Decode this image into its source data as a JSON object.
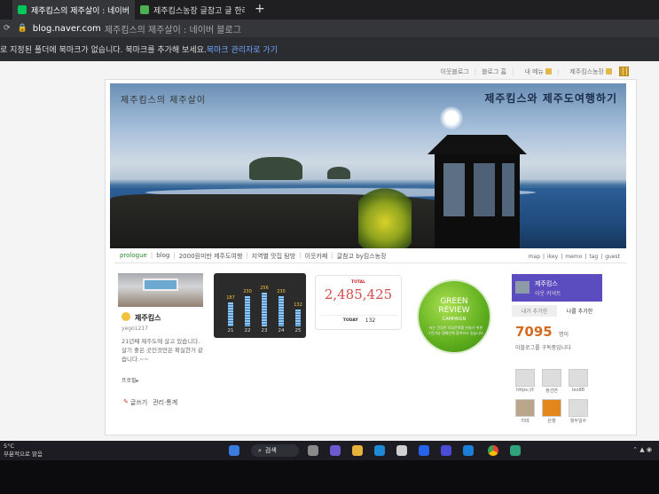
{
  "browser": {
    "tabs": [
      {
        "title": "제주킴스의 제주살이 : 네이버 블"
      },
      {
        "title": "제주킴스농장 글참고 글 한라봉"
      }
    ],
    "newtab": "+",
    "nav_label": "☰",
    "address_host": "blog.naver.com",
    "address_title": "제주킴스의 제주살이 : 네이버 블로그",
    "bookmark_msg": "로 지정된 폴더에 북마크가 없습니다. 북마크를 추가해 보세요.",
    "bookmark_link": "북마크 관리자로 가기"
  },
  "topnav": [
    "이웃블로그",
    "블로그 홈",
    "내 메뉴",
    "제주킴스농장"
  ],
  "banner": {
    "left_title": "제주킴스의 제주살이",
    "right_title": "제주킴스와 제주도여행하기"
  },
  "menu": {
    "items": [
      "prologue",
      "blog",
      "2000원미만 제주도여행",
      "지역별 맛집 탐방",
      "이웃카페",
      "글참고 by킴스농장"
    ],
    "right": [
      "map",
      "ikey",
      "memo",
      "tag",
      "guest"
    ]
  },
  "profile": {
    "name": "제주킴스",
    "id": "yego1217",
    "desc": "21년째 제주도에 살고 있습니다. 살기 좋은 곳인것만은 확실한거 같습니다.~~",
    "link": "프로필▸",
    "write": "글쓰기",
    "manage": "관리·통계"
  },
  "visitors": {
    "days": [
      "21",
      "22",
      "23",
      "24",
      "25"
    ],
    "values": [
      187,
      230,
      256,
      230,
      132
    ]
  },
  "counter": {
    "label": "TOTAL",
    "total": "2,485,425",
    "today_label": "TODAY",
    "today": "132"
  },
  "green_review": {
    "title1": "GREEN",
    "title2": "REVIEW",
    "subtitle": "CAMPAIGN",
    "desc": "저는 건강한 리뷰문화를 만들기 위한 그린리뷰 캠페인에 참여하고 있습니다."
  },
  "neighbors": {
    "name": "제주킴스",
    "sub": "이웃 커넥트",
    "tab_on": "내가 추가한",
    "tab_off": "나를 추가한",
    "count": "7095",
    "unit": "명이",
    "msg": "이블로그를 구독중입니다",
    "friends": [
      "https://t",
      "정선연",
      "leo88",
      "리데",
      "은향",
      "월두일수"
    ]
  },
  "taskbar": {
    "temp": "5°C",
    "weather": "부분적으로 맑음",
    "search": "검색"
  },
  "colors": {
    "naver_green": "#03c75a",
    "neighbor_purple": "#5b4dbf",
    "counter_red": "#d34b4b",
    "count_orange": "#d46b20"
  }
}
